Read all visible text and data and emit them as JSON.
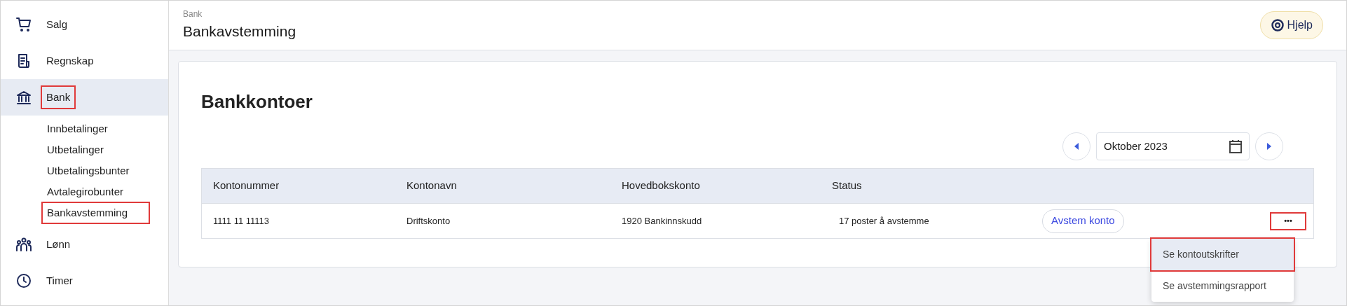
{
  "sidebar": {
    "items": [
      {
        "label": "Salg",
        "selected": false,
        "highlighted": false
      },
      {
        "label": "Regnskap",
        "selected": false,
        "highlighted": false
      },
      {
        "label": "Bank",
        "selected": true,
        "highlighted": true,
        "children": [
          {
            "label": "Innbetalinger",
            "highlighted": false
          },
          {
            "label": "Utbetalinger",
            "highlighted": false
          },
          {
            "label": "Utbetalingsbunter",
            "highlighted": false
          },
          {
            "label": "Avtalegirobunter",
            "highlighted": false
          },
          {
            "label": "Bankavstemming",
            "highlighted": true
          }
        ]
      },
      {
        "label": "Lønn",
        "selected": false,
        "highlighted": false
      },
      {
        "label": "Timer",
        "selected": false,
        "highlighted": false
      }
    ]
  },
  "header": {
    "breadcrumb": "Bank",
    "title": "Bankavstemming",
    "help_button": "Hjelp"
  },
  "card": {
    "title": "Bankkontoer",
    "period": "Oktober 2023",
    "table": {
      "columns": [
        "Kontonummer",
        "Kontonavn",
        "Hovedbokskonto",
        "Status"
      ],
      "rows": [
        {
          "kontonummer": "1111 11 11113",
          "kontonavn": "Driftskonto",
          "hovedbokskonto": "1920 Bankinnskudd",
          "status": "17 poster å avstemme",
          "action": "Avstem konto",
          "more": "•••",
          "more_highlighted": true
        }
      ]
    }
  },
  "menu": {
    "items": [
      {
        "label": "Se kontoutskrifter",
        "selected": true,
        "highlighted": true
      },
      {
        "label": "Se avstemmingsrapport",
        "selected": false,
        "highlighted": false
      }
    ]
  }
}
